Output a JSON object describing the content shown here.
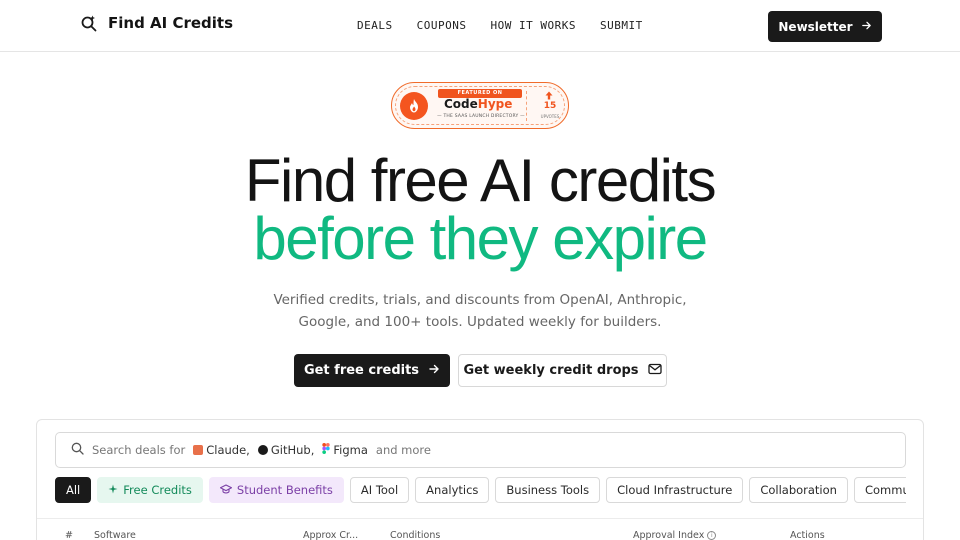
{
  "header": {
    "brand": "Find AI Credits",
    "nav": [
      "DEALS",
      "COUPONS",
      "HOW IT WORKS",
      "SUBMIT"
    ],
    "newsletter_label": "Newsletter"
  },
  "badge": {
    "featured": "FEATURED ON",
    "name_part1": "Code",
    "name_part2": "Hype",
    "tagline": "— THE SAAS LAUNCH DIRECTORY —",
    "count": "15",
    "count_label": "UPVOTES"
  },
  "hero": {
    "line1": "Find free AI credits",
    "line2": "before they expire",
    "subtitle": "Verified credits, trials, and discounts from OpenAI, Anthropic, Google, and 100+ tools. Updated weekly for builders.",
    "cta_primary": "Get free credits",
    "cta_secondary": "Get weekly credit drops"
  },
  "search": {
    "prefix": "Search deals for",
    "brands": [
      "Claude,",
      "GitHub,",
      "Figma"
    ],
    "suffix": "and more"
  },
  "filters": [
    "All",
    "Free Credits",
    "Student Benefits",
    "AI Tool",
    "Analytics",
    "Business Tools",
    "Cloud Infrastructure",
    "Collaboration",
    "Communications"
  ],
  "table": {
    "columns": [
      "#",
      "Software",
      "Approx Cr...",
      "Conditions",
      "Approval Index",
      "Actions"
    ]
  },
  "colors": {
    "accent_green": "#10b981",
    "badge_orange": "#f0541e",
    "dark": "#1a1a1a"
  }
}
